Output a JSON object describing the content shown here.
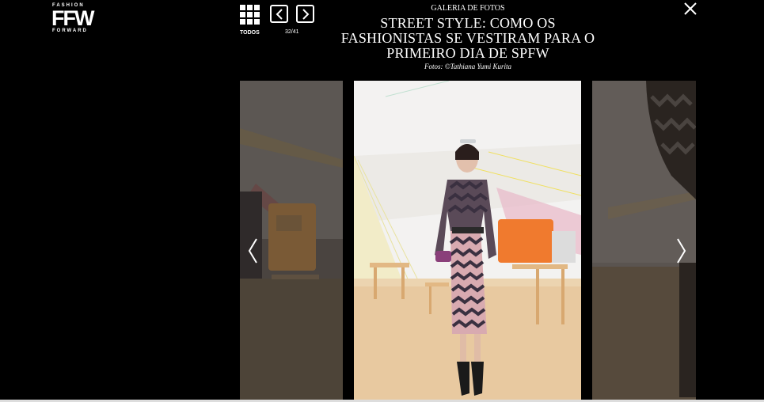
{
  "logo": {
    "top_text": "FASHION",
    "main_text": "FFW",
    "bottom_text": "FORWARD"
  },
  "toolbar": {
    "all_label": "TODOS",
    "counter": "32/41"
  },
  "header": {
    "section_label": "GALERIA DE FOTOS",
    "title": "STREET STYLE: COMO OS FASHIONISTAS SE VESTIRAM PARA O PRIMEIRO DIA DE SPFW",
    "credit": "Fotos: ©Tathiana Yumi Kurita"
  },
  "icons": {
    "grid": "grid-icon",
    "prev": "chevron-left-icon",
    "next": "chevron-right-icon",
    "close": "close-icon"
  },
  "colors": {
    "background": "#000000",
    "text": "#ffffff"
  }
}
